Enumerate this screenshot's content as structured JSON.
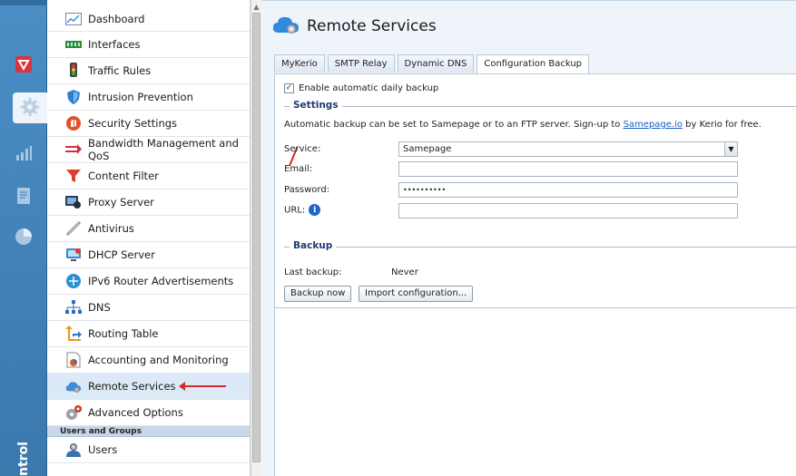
{
  "rail": {
    "label": "ntrol",
    "items": [
      {
        "icon": "shield-icon"
      },
      {
        "icon": "gear-icon"
      },
      {
        "icon": "bar-chart-icon"
      },
      {
        "icon": "document-icon"
      },
      {
        "icon": "pie-chart-icon"
      }
    ]
  },
  "nav": {
    "items": [
      {
        "label": "Dashboard",
        "icon": "dashboard-icon"
      },
      {
        "label": "Interfaces",
        "icon": "interfaces-icon"
      },
      {
        "label": "Traffic Rules",
        "icon": "traffic-rules-icon"
      },
      {
        "label": "Intrusion Prevention",
        "icon": "shield-icon"
      },
      {
        "label": "Security Settings",
        "icon": "security-icon"
      },
      {
        "label": "Bandwidth Management and QoS",
        "icon": "bandwidth-icon"
      },
      {
        "label": "Content Filter",
        "icon": "filter-icon"
      },
      {
        "label": "Proxy Server",
        "icon": "proxy-icon"
      },
      {
        "label": "Antivirus",
        "icon": "antivirus-icon"
      },
      {
        "label": "DHCP Server",
        "icon": "dhcp-icon"
      },
      {
        "label": "IPv6 Router Advertisements",
        "icon": "ipv6-icon"
      },
      {
        "label": "DNS",
        "icon": "dns-icon"
      },
      {
        "label": "Routing Table",
        "icon": "routing-icon"
      },
      {
        "label": "Accounting and Monitoring",
        "icon": "accounting-icon"
      },
      {
        "label": "Remote Services",
        "icon": "cloud-icon"
      },
      {
        "label": "Advanced Options",
        "icon": "gears-icon"
      }
    ],
    "group_label": "Users and Groups",
    "group_items": [
      {
        "label": "Users",
        "icon": "users-icon"
      }
    ]
  },
  "main": {
    "title": "Remote Services",
    "tabs": [
      {
        "label": "MyKerio"
      },
      {
        "label": "SMTP Relay"
      },
      {
        "label": "Dynamic DNS"
      },
      {
        "label": "Configuration Backup"
      }
    ],
    "enable_backup_label": "Enable automatic daily backup",
    "enable_backup_checked": true,
    "settings": {
      "legend": "Settings",
      "info_prefix": "Automatic backup can be set to Samepage or to an FTP server. Sign-up to ",
      "info_link": "Samepage.io",
      "info_suffix": " by Kerio for free.",
      "service_label": "Service:",
      "service_value": "Samepage",
      "email_label": "Email:",
      "email_value": "",
      "password_label": "Password:",
      "password_value": "••••••••••",
      "url_label": "URL:",
      "url_value": ""
    },
    "backup": {
      "legend": "Backup",
      "last_backup_label": "Last backup:",
      "last_backup_value": "Never",
      "backup_now_label": "Backup now",
      "import_label": "Import configuration..."
    }
  },
  "colors": {
    "accent_red": "#d42a2a",
    "rail_blue": "#3a78ae",
    "link_blue": "#1a5cc5",
    "legend_blue": "#1f3a70"
  }
}
